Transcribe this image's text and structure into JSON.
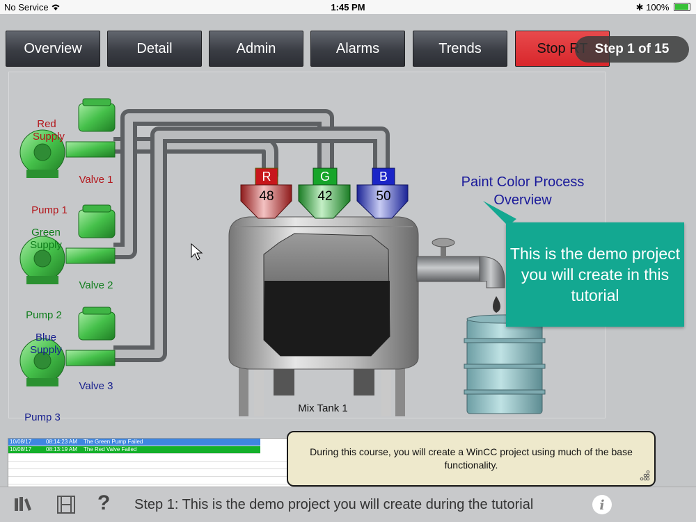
{
  "status_bar": {
    "carrier": "No Service",
    "time": "1:45 PM",
    "battery": "100%"
  },
  "nav": {
    "buttons": [
      "Overview",
      "Detail",
      "Admin",
      "Alarms",
      "Trends",
      "Stop RT"
    ]
  },
  "step_badge": "Step 1 of 15",
  "process": {
    "title_line1": "Paint Color Process",
    "title_line2": "Overview",
    "red_supply": "Red\nSupply",
    "green_supply": "Green\nSupply",
    "blue_supply": "Blue\nSupply",
    "valve1": "Valve 1",
    "valve2": "Valve 2",
    "valve3": "Valve 3",
    "pump1": "Pump 1",
    "pump2": "Pump 2",
    "pump3": "Pump 3",
    "hoppers": [
      {
        "letter": "R",
        "value": "48",
        "color": "#c8161b"
      },
      {
        "letter": "G",
        "value": "42",
        "color": "#17a52a"
      },
      {
        "letter": "B",
        "value": "50",
        "color": "#1a24c7"
      }
    ],
    "tank_label": "Mix Tank 1"
  },
  "callout": "This is the demo project you will create in this tutorial",
  "alarms": [
    {
      "date": "10/08/17",
      "time": "08:14:23 AM",
      "text": "The Green Pump Failed",
      "color": "#3e86e0"
    },
    {
      "date": "10/08/17",
      "time": "08:13:19 AM",
      "text": "The Red Valve Failed",
      "color": "#14b02a"
    }
  ],
  "description": "During this course, you will create a WinCC project using much of the base functionality.",
  "bottom": {
    "step_text": "Step 1: This is the demo project you will create during the tutorial"
  }
}
